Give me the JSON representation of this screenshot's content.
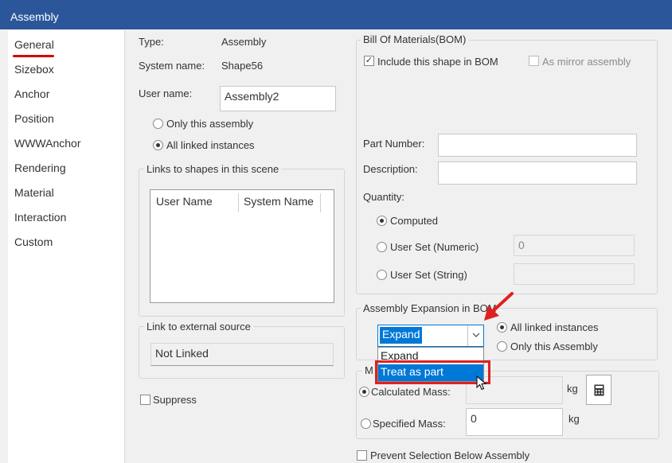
{
  "window": {
    "title": "Assembly"
  },
  "sidebar": {
    "items": [
      "General",
      "Sizebox",
      "Anchor",
      "Position",
      "WWWAnchor",
      "Rendering",
      "Material",
      "Interaction",
      "Custom"
    ],
    "active_index": 0
  },
  "general": {
    "type_label": "Type:",
    "type_value": "Assembly",
    "system_name_label": "System name:",
    "system_name_value": "Shape56",
    "user_name_label": "User name:",
    "user_name_value": "Assembly2",
    "radio_only_this": "Only this assembly",
    "radio_all_linked": "All linked instances",
    "links_group_title": "Links to shapes in this scene",
    "links_columns": [
      "User Name",
      "System Name"
    ],
    "external_group_title": "Link to external source",
    "external_value": "Not Linked",
    "suppress_label": "Suppress"
  },
  "bom": {
    "group_title": "Bill Of Materials(BOM)",
    "include_label": "Include this shape in BOM",
    "include_checked": true,
    "mirror_label": "As mirror assembly",
    "part_number_label": "Part Number:",
    "part_number_value": "",
    "description_label": "Description:",
    "description_value": "",
    "quantity_label": "Quantity:",
    "computed_label": "Computed",
    "user_numeric_label": "User Set (Numeric)",
    "user_numeric_value": "0",
    "user_string_label": "User Set (String)",
    "user_string_value": ""
  },
  "expansion": {
    "group_title": "Assembly Expansion in BOM",
    "combo_value": "Expand",
    "options": [
      "Expand",
      "Treat as part"
    ],
    "highlighted_option": "Treat as part",
    "radio_all_linked": "All linked instances",
    "radio_only_this": "Only this Assembly"
  },
  "mass": {
    "group_title_visible": "M",
    "calculated_label": "Calculated Mass:",
    "calculated_value": "",
    "calculated_unit": "kg",
    "specified_label": "Specified Mass:",
    "specified_value": "0",
    "specified_unit": "kg"
  },
  "prevent_selection_label": "Prevent Selection Below Assembly",
  "colors": {
    "titlebar": "#2b579a",
    "selection": "#0078d7",
    "annotation": "#e02020"
  }
}
